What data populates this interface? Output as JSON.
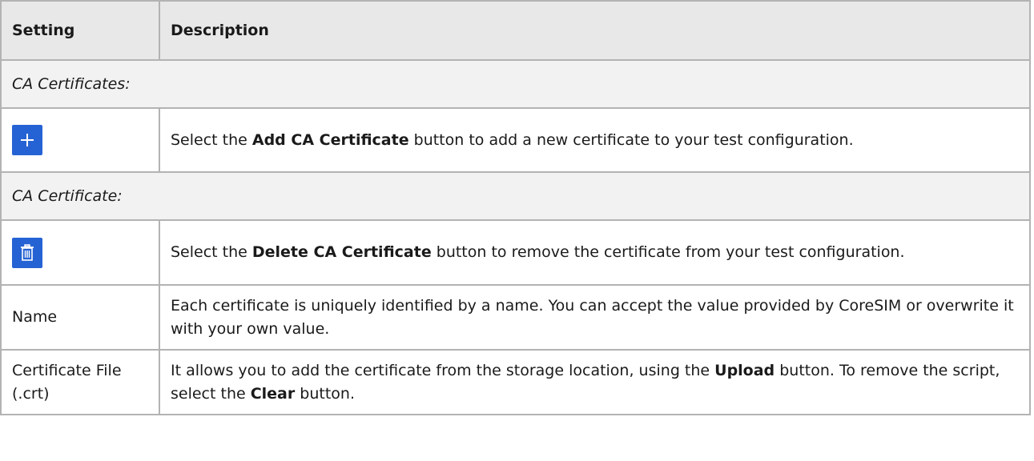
{
  "table": {
    "headers": {
      "setting": "Setting",
      "description": "Description"
    },
    "sections": {
      "ca_certificates": "CA Certificates:",
      "ca_certificate": "CA Certificate:"
    },
    "rows": {
      "add": {
        "icon": "plus-icon",
        "desc_pre": "Select the ",
        "desc_bold": "Add CA Certificate",
        "desc_post": " button to add a new certificate to your test configuration."
      },
      "delete": {
        "icon": "trash-icon",
        "desc_pre": "Select the ",
        "desc_bold": "Delete CA Certificate",
        "desc_post": " button to remove the certificate from your test configuration."
      },
      "name": {
        "setting": "Name",
        "desc": "Each certificate is uniquely identified by a name. You can accept the value provided by CoreSIM or overwrite it with your own value."
      },
      "cert_file": {
        "setting": "Certificate File (.crt)",
        "desc_pre": "It allows you to add the certificate from the storage location, using the ",
        "desc_bold1": "Upload",
        "desc_mid": " button. To remove the script, select the ",
        "desc_bold2": "Clear",
        "desc_post": " button."
      }
    }
  },
  "colors": {
    "icon_button_bg": "#2563d4",
    "header_bg": "#e8e8e8",
    "section_bg": "#f2f2f2",
    "border": "#b3b3b3"
  }
}
